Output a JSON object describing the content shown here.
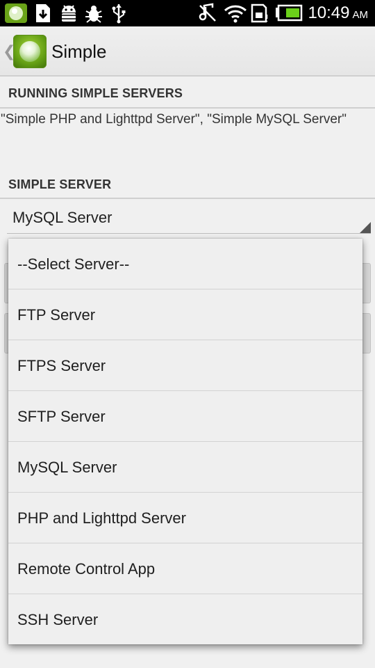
{
  "status_bar": {
    "time": "10:49",
    "ampm": "AM",
    "icons": [
      "simple-app-icon",
      "download-icon",
      "android-debug-icon",
      "bug-icon",
      "usb-icon",
      "music-muted-icon",
      "wifi-icon",
      "sd-card-icon",
      "battery-icon"
    ]
  },
  "action_bar": {
    "title": "Simple",
    "up_icon": "chevron-left-icon",
    "app_icon": "simple-app-icon"
  },
  "sections": {
    "running_header": "RUNNING SIMPLE SERVERS",
    "running_text": "\"Simple PHP and Lighttpd Server\", \"Simple MySQL Server\"",
    "simple_header": "SIMPLE SERVER"
  },
  "spinner": {
    "selected": "MySQL Server"
  },
  "dropdown": {
    "options": [
      "--Select Server--",
      "FTP Server",
      "FTPS Server",
      "SFTP Server",
      "MySQL Server",
      "PHP and Lighttpd Server",
      "Remote Control App",
      "SSH Server"
    ]
  },
  "colors": {
    "status_bar": "#000000",
    "background": "#f0f0f0",
    "battery_fill": "#6bd01a",
    "app_icon_green": "#5f9a12"
  }
}
